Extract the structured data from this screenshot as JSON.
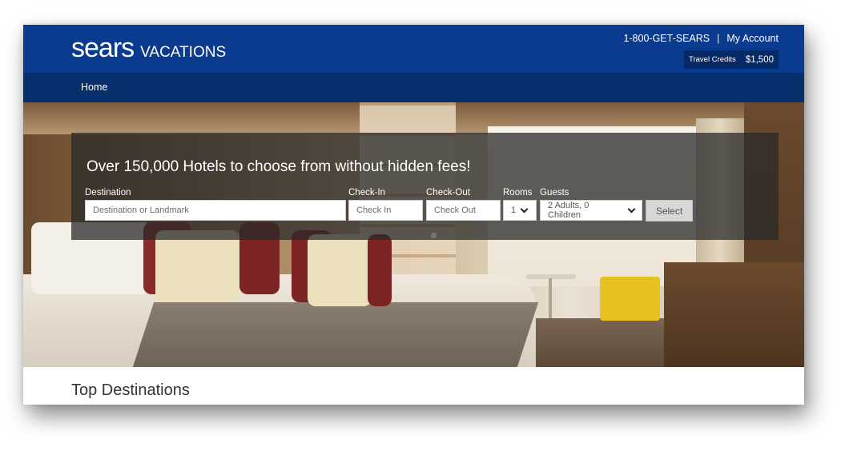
{
  "header": {
    "brand": "sears",
    "brand_sub": "VACATIONS",
    "phone": "1-800-GET-SEARS",
    "separator": "|",
    "account_link": "My Account",
    "credits_label": "Travel Credits",
    "credits_amount": "$1,500"
  },
  "nav": {
    "home": "Home"
  },
  "search": {
    "headline": "Over 150,000 Hotels to choose from without hidden fees!",
    "destination_label": "Destination",
    "destination_placeholder": "Destination or Landmark",
    "checkin_label": "Check-In",
    "checkin_placeholder": "Check In",
    "checkout_label": "Check-Out",
    "checkout_placeholder": "Check Out",
    "rooms_label": "Rooms",
    "rooms_value": "1",
    "guests_label": "Guests",
    "guests_value": "2 Adults, 0 Children",
    "select_button": "Select"
  },
  "main": {
    "section_title": "Top Destinations"
  },
  "colors": {
    "header_blue": "#0b3b8e",
    "nav_blue": "#062f6e",
    "credits_bg": "#062a66",
    "panel_overlay": "#282828"
  },
  "icons": {
    "rooms_dropdown": "chevron-down-icon",
    "guests_dropdown": "chevron-down-icon"
  }
}
